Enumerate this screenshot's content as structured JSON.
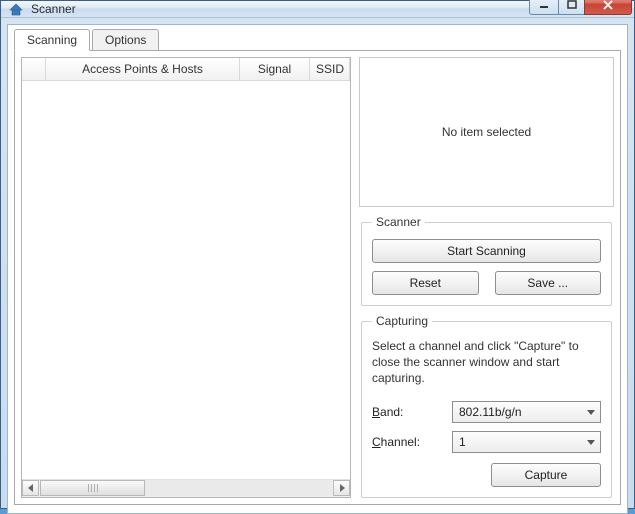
{
  "window": {
    "title": "Scanner"
  },
  "tabs": {
    "scanning": "Scanning",
    "options": "Options"
  },
  "list": {
    "columns": {
      "access": "Access Points & Hosts",
      "signal": "Signal",
      "ssid": "SSID"
    }
  },
  "info": {
    "empty": "No item selected"
  },
  "scanner": {
    "legend": "Scanner",
    "start": "Start Scanning",
    "reset": "Reset",
    "save": "Save ..."
  },
  "capturing": {
    "legend": "Capturing",
    "help": "Select a channel and click \"Capture\" to close the scanner window and start capturing.",
    "band_label_under": "B",
    "band_label_rest": "and:",
    "channel_label_under": "C",
    "channel_label_rest": "hannel:",
    "band_value": "802.11b/g/n",
    "channel_value": "1",
    "capture": "Capture"
  }
}
